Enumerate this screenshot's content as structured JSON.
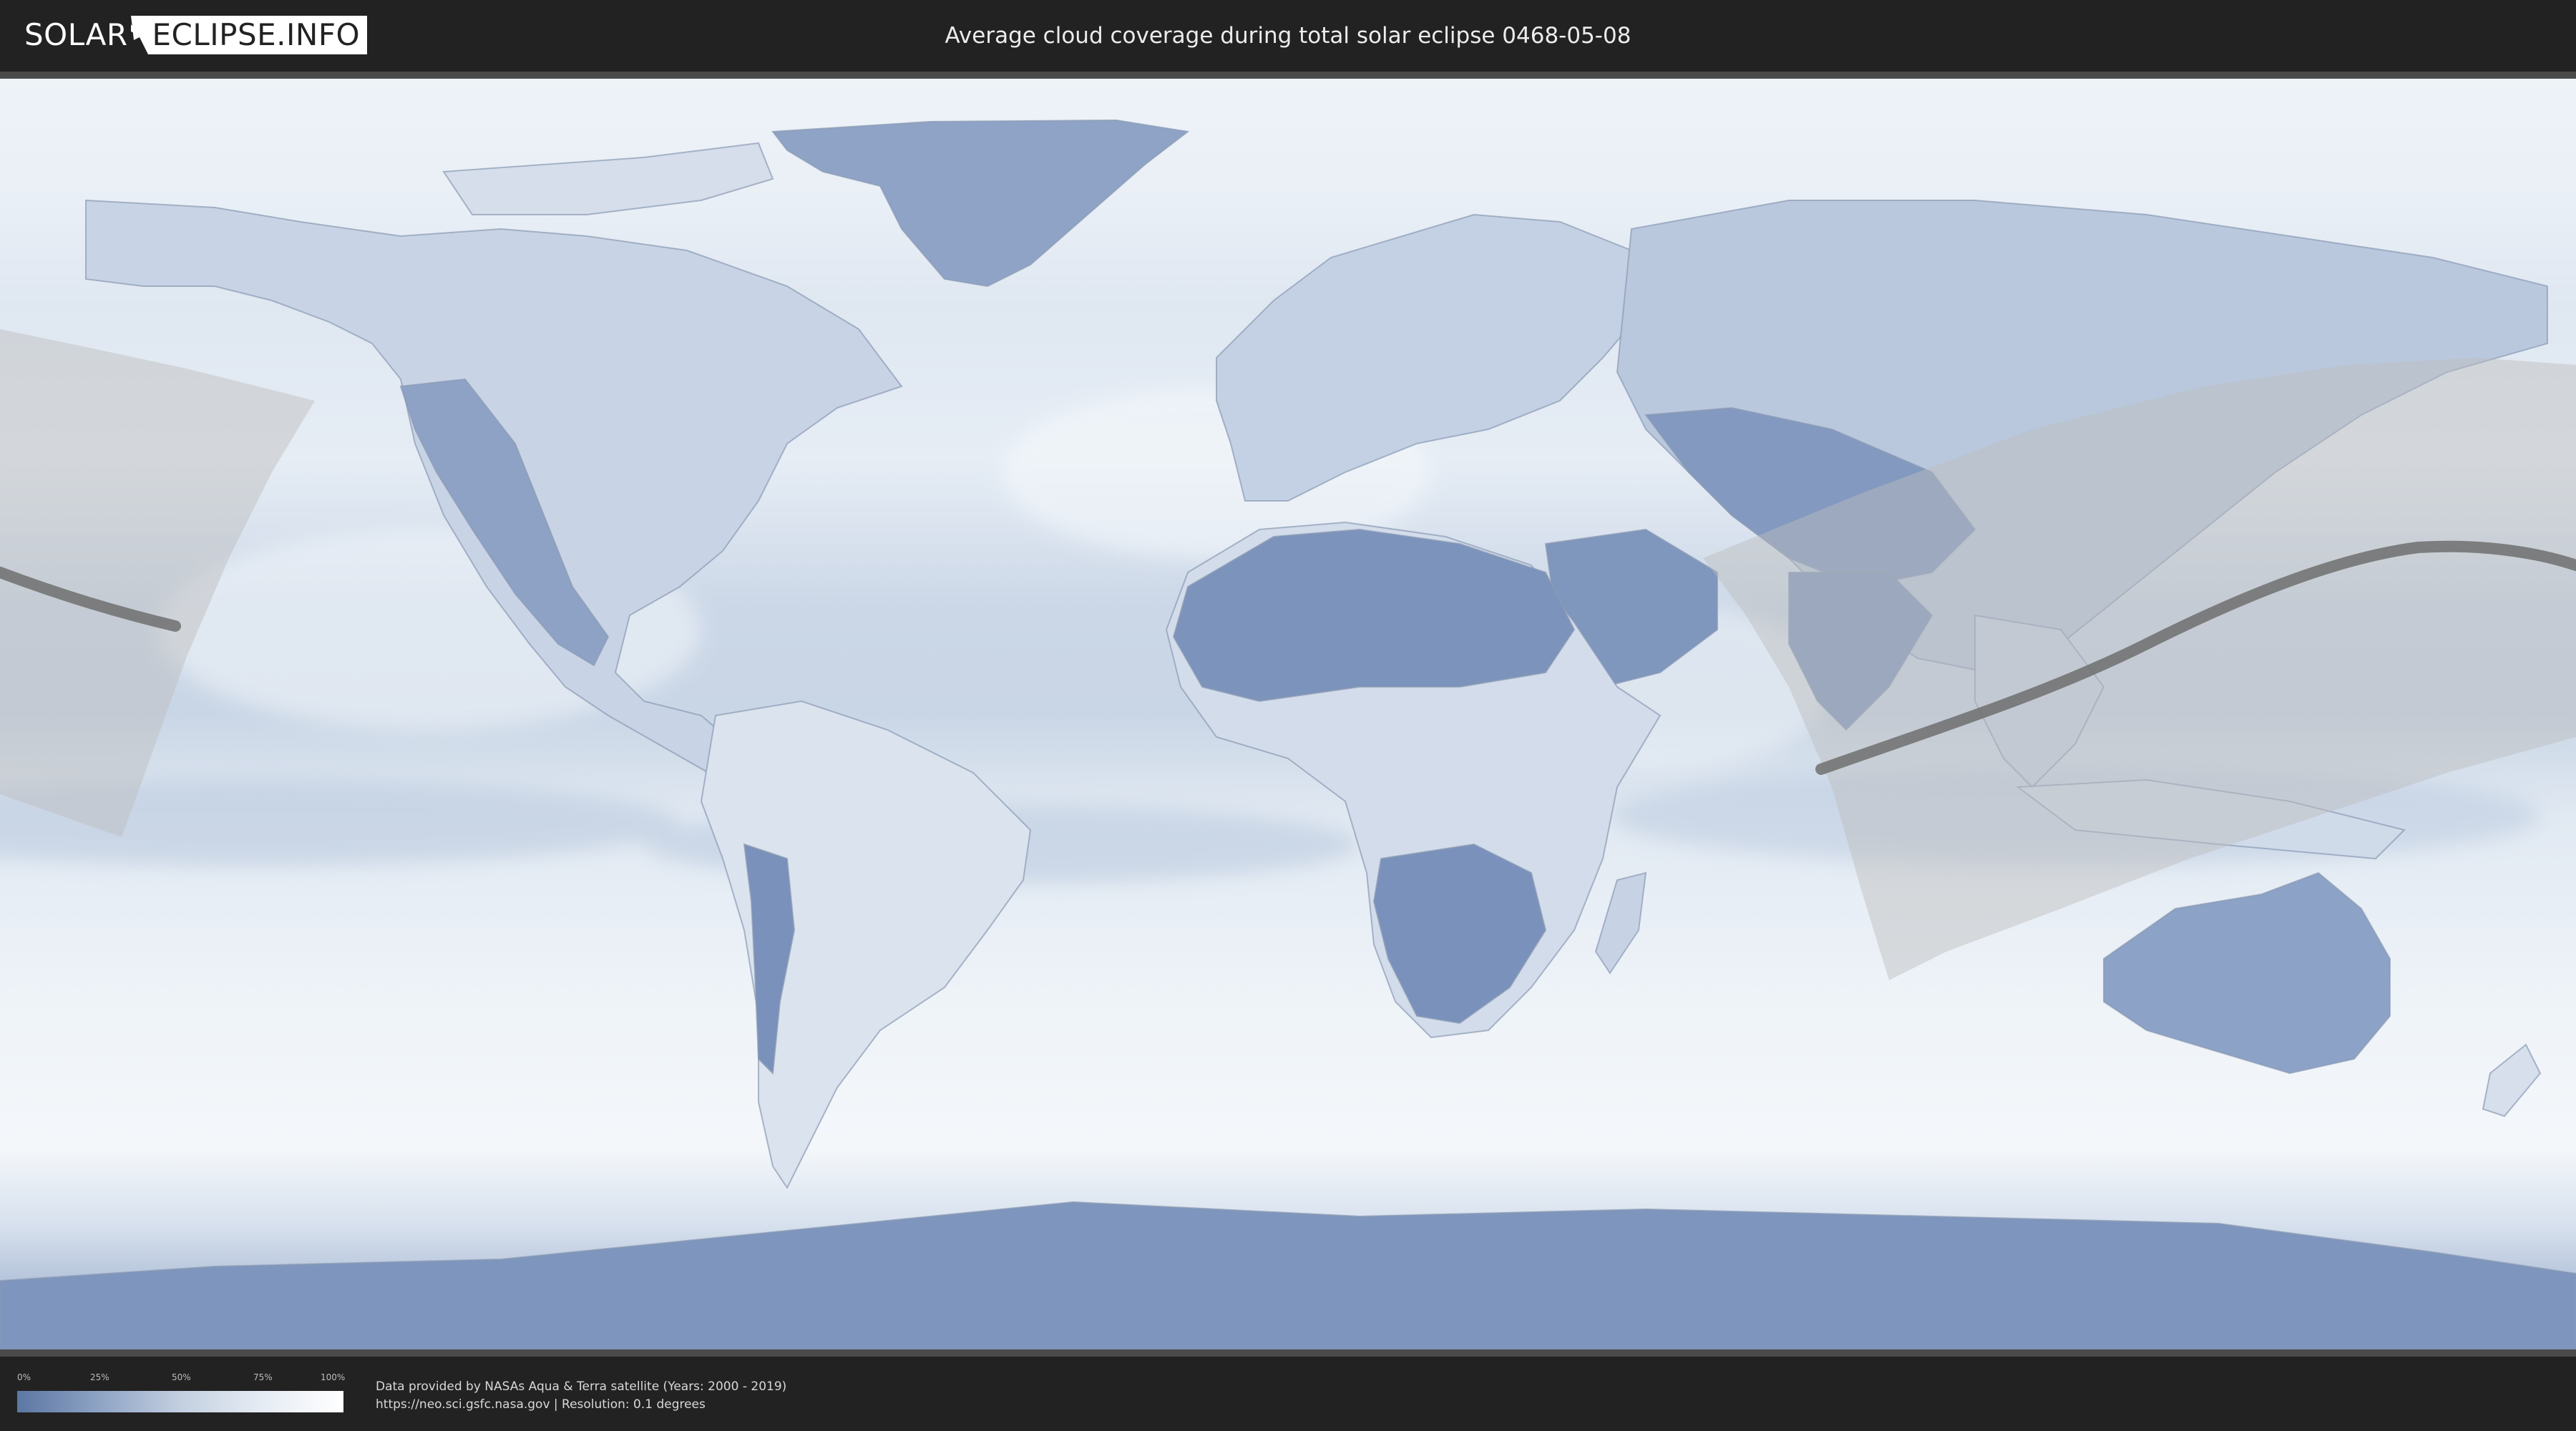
{
  "header": {
    "logo_left": "SOLAR",
    "logo_right": "ECLIPSE.INFO",
    "title": "Average cloud coverage during total solar eclipse 0468-05-08"
  },
  "map": {
    "eclipse_date": "0468-05-08",
    "colors": {
      "clear_sky": "#5c77a3",
      "overcast": "#ffffff",
      "eclipse_path": "#6e6e6e",
      "visibility_zone": "#bdbdbd"
    }
  },
  "legend": {
    "ticks": [
      "0%",
      "25%",
      "50%",
      "75%",
      "100%"
    ],
    "tick_fractions": [
      0,
      0.25,
      0.5,
      0.75,
      1.0
    ]
  },
  "footer": {
    "credit_line_1": "Data provided by NASAs Aqua & Terra satellite (Years: 2000 - 2019)",
    "credit_line_2": "https://neo.sci.gsfc.nasa.gov | Resolution: 0.1 degrees"
  }
}
